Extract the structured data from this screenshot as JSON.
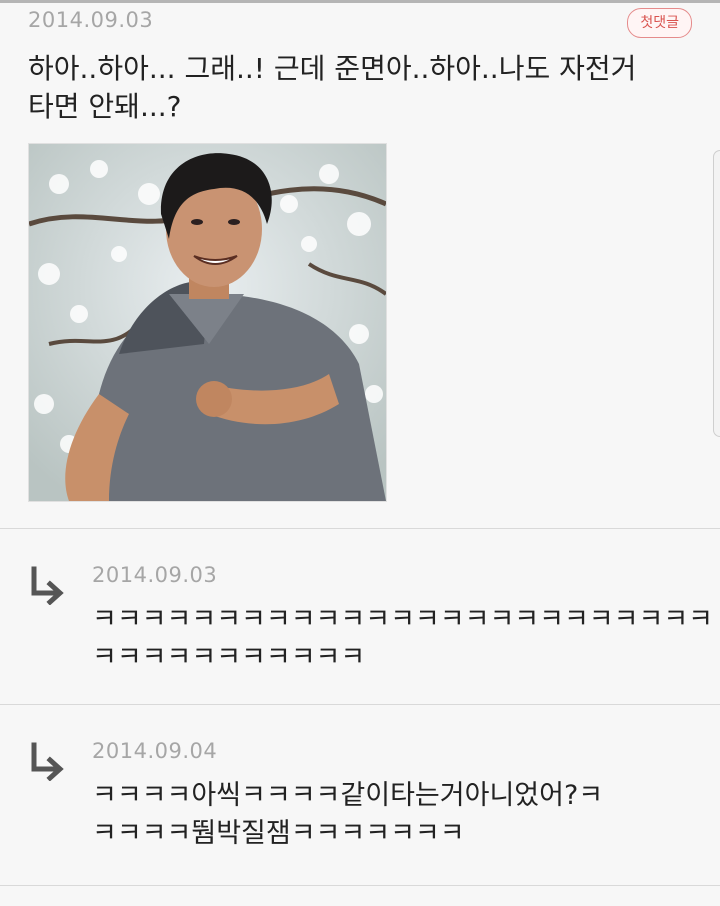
{
  "comment": {
    "date": "2014.09.03",
    "badge": "첫댓글",
    "body_lines": [
      "하아..하아... 그래..! 근데 준면아..하아..나도 자전거",
      "타면 안돼...?"
    ]
  },
  "replies": [
    {
      "date": "2014.09.03",
      "body_lines": [
        "ㅋㅋㅋㅋㅋㅋㅋㅋㅋㅋㅋㅋㅋㅋㅋㅋㅋㅋㅋㅋㅋㅋㅋㅋㅋ",
        "ㅋㅋㅋㅋㅋㅋㅋㅋㅋㅋㅋ"
      ]
    },
    {
      "date": "2014.09.04",
      "body_lines": [
        "ㅋㅋㅋㅋ아씩ㅋㅋㅋㅋ같이타는거아니었어?ㅋ",
        "ㅋㅋㅋㅋ뛈박질잼ㅋㅋㅋㅋㅋㅋㅋ"
      ]
    }
  ],
  "colors": {
    "accent": "#d9534f",
    "date": "#a6a6a6",
    "text": "#222222",
    "arrow": "#555555"
  },
  "icons": {
    "reply": "reply-arrow-icon"
  }
}
